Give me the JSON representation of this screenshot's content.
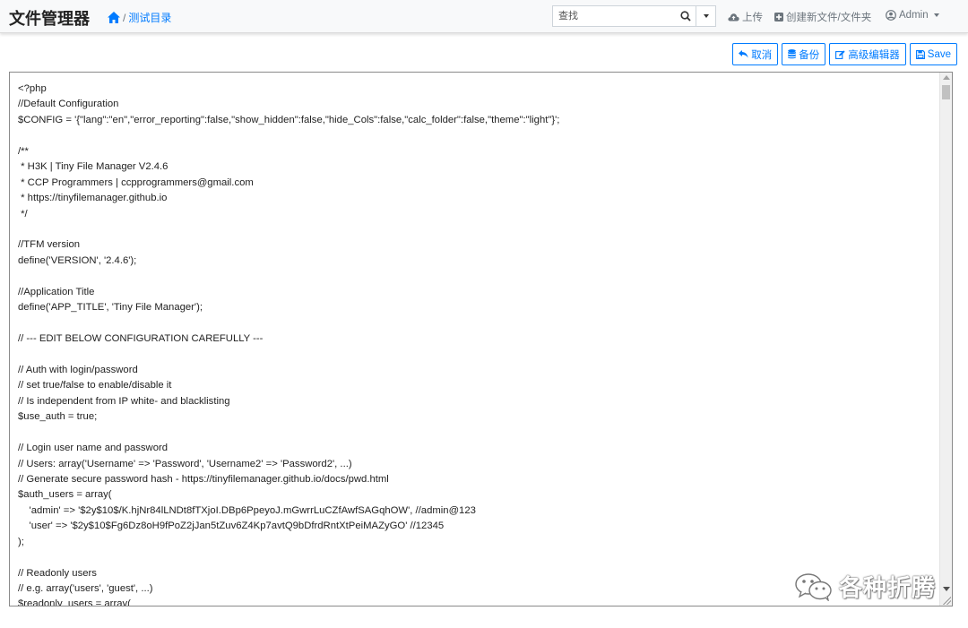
{
  "app": {
    "title": "文件管理器"
  },
  "breadcrumb": {
    "home_icon": "home-icon",
    "separator": "/",
    "current": "测试目录"
  },
  "search": {
    "placeholder": "查找",
    "search_icon": "search-icon",
    "dropdown_icon": "caret-down-icon"
  },
  "nav": {
    "upload": {
      "label": "上传",
      "icon": "cloud-upload-icon"
    },
    "create": {
      "label": "创建新文件/文件夹",
      "icon": "plus-square-icon"
    },
    "user": {
      "label": "Admin",
      "icon": "user-circle-icon"
    }
  },
  "toolbar": {
    "cancel": {
      "label": "取消",
      "icon": "reply-icon"
    },
    "backup": {
      "label": "备份",
      "icon": "database-icon"
    },
    "advanced": {
      "label": "高级编辑器",
      "icon": "edit-icon"
    },
    "save": {
      "label": "Save",
      "icon": "floppy-icon"
    }
  },
  "colors": {
    "accent": "#007bff",
    "navbar_bg": "#f8f9fa",
    "text": "#212529",
    "muted": "#6c757d"
  },
  "editor": {
    "lines": [
      "<?php",
      "//Default Configuration",
      "$CONFIG = '{\"lang\":\"en\",\"error_reporting\":false,\"show_hidden\":false,\"hide_Cols\":false,\"calc_folder\":false,\"theme\":\"light\"}';",
      "",
      "/**",
      " * H3K | Tiny File Manager V2.4.6",
      " * CCP Programmers | ccpprogrammers@gmail.com",
      " * https://tinyfilemanager.github.io",
      " */",
      "",
      "//TFM version",
      "define('VERSION', '2.4.6');",
      "",
      "//Application Title",
      "define('APP_TITLE', 'Tiny File Manager');",
      "",
      "// --- EDIT BELOW CONFIGURATION CAREFULLY ---",
      "",
      "// Auth with login/password",
      "// set true/false to enable/disable it",
      "// Is independent from IP white- and blacklisting",
      "$use_auth = true;",
      "",
      "// Login user name and password",
      "// Users: array('Username' => 'Password', 'Username2' => 'Password2', ...)",
      "// Generate secure password hash - https://tinyfilemanager.github.io/docs/pwd.html",
      "$auth_users = array(",
      "    'admin' => '$2y$10$/K.hjNr84lLNDt8fTXjoI.DBp6PpeyoJ.mGwrrLuCZfAwfSAGqhOW', //admin@123",
      "    'user' => '$2y$10$Fg6Dz8oH9fPoZ2jJan5tZuv6Z4Kp7avtQ9bDfrdRntXtPeiMAZyGO' //12345",
      ");",
      "",
      "// Readonly users",
      "// e.g. array('users', 'guest', ...)",
      "$readonly_users = array("
    ]
  },
  "watermark": {
    "text": "各种折腾",
    "icon": "wechat-icon"
  }
}
